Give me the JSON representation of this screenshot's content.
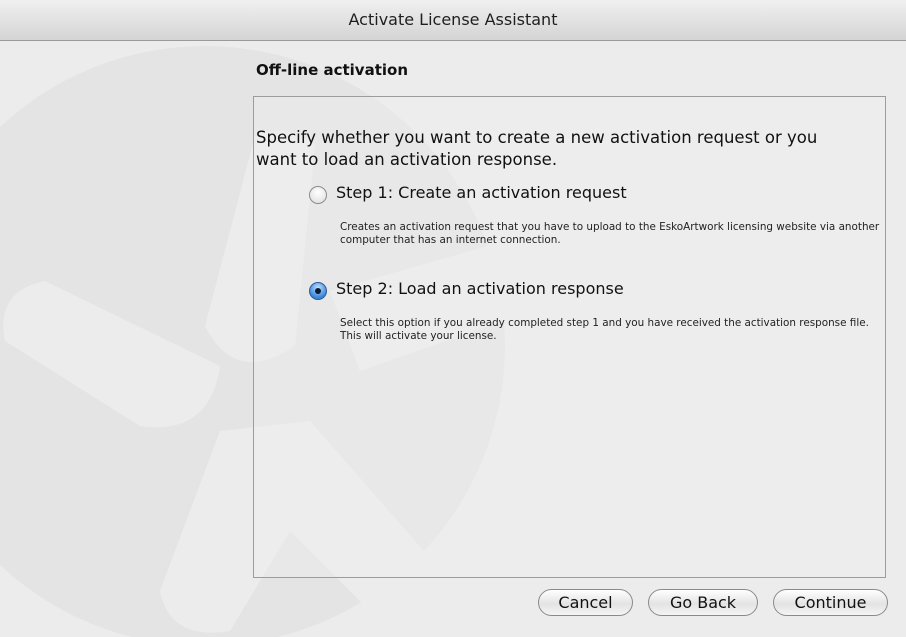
{
  "window": {
    "title": "Activate License Assistant"
  },
  "page": {
    "heading": "Off-line activation"
  },
  "panel": {
    "intro": "Specify whether you want to create a new activation request or you want to load an activation response.",
    "options": [
      {
        "label": "Step 1: Create an activation request",
        "description": "Creates an activation request that you have to upload to the EskoArtwork licensing website via another computer that has an internet connection.",
        "selected": false
      },
      {
        "label": "Step 2: Load an activation response",
        "description": "Select this option if you already completed step 1 and you have received the activation response file. This will activate your license.",
        "selected": true
      }
    ]
  },
  "buttons": {
    "cancel": "Cancel",
    "back": "Go Back",
    "continue": "Continue"
  },
  "colors": {
    "window_bg": "#ececec",
    "radio_selected": "#3a86d8",
    "background_logo": "#e2e2e2"
  }
}
